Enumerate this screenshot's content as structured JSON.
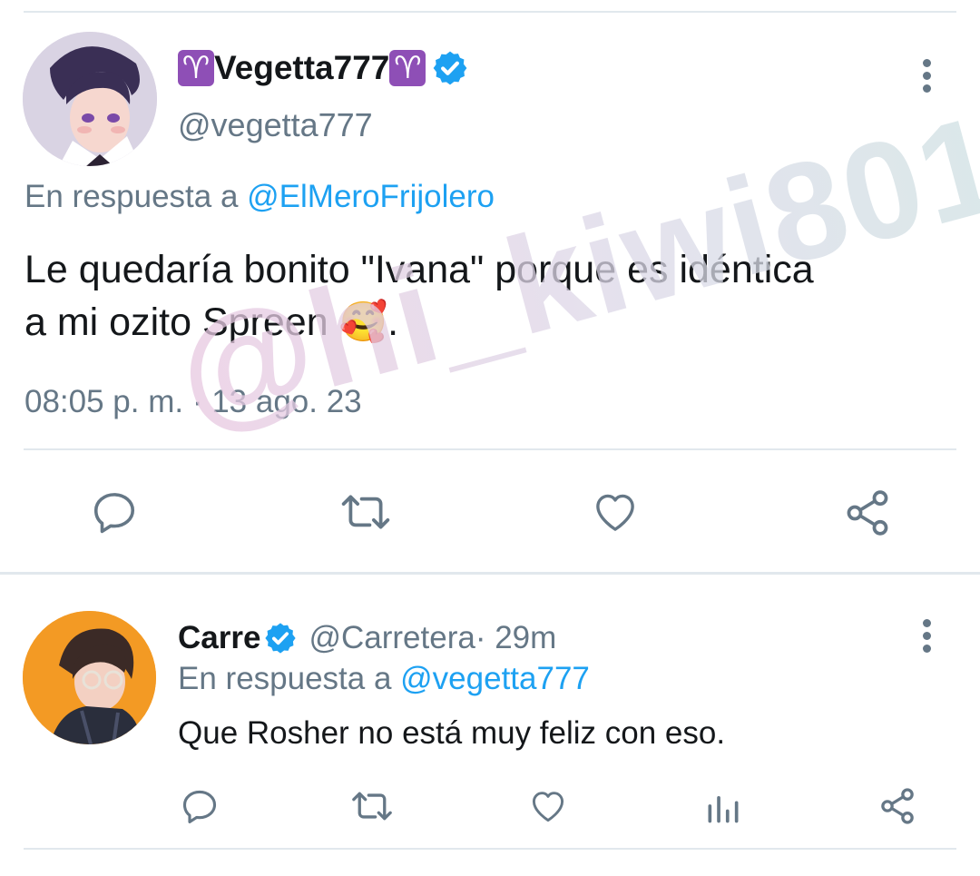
{
  "tweet_main": {
    "name_prefix_emoji": "♈",
    "display_name": "Vegetta777",
    "name_suffix_emoji": "♈",
    "handle": "@vegetta777",
    "reply_prefix": "En respuesta a ",
    "reply_mention": "@ElMeroFrijolero",
    "text_line1": "Le quedaría bonito \"Ivana\" porque es idéntica",
    "text_line2": "a mi ozito Spreen ",
    "text_emoji": "🥰",
    "text_end": ".",
    "timestamp": "08:05 p. m. · 13 ago. 23"
  },
  "tweet_reply": {
    "display_name": "Carre",
    "handle": "@Carretera",
    "time": " · 29m",
    "reply_prefix": "En respuesta a ",
    "reply_mention": "@vegetta777",
    "text": "Que Rosher no está muy feliz con eso."
  },
  "watermark": "@hi_kiwi801",
  "colors": {
    "secondary_text": "#657786",
    "link": "#1da1f2",
    "verified": "#1da1f2",
    "aries_badge": "#8e4fb6"
  },
  "icons": [
    "reply-icon",
    "retweet-icon",
    "like-icon",
    "share-icon",
    "analytics-icon",
    "more-options-icon",
    "verified-icon"
  ]
}
